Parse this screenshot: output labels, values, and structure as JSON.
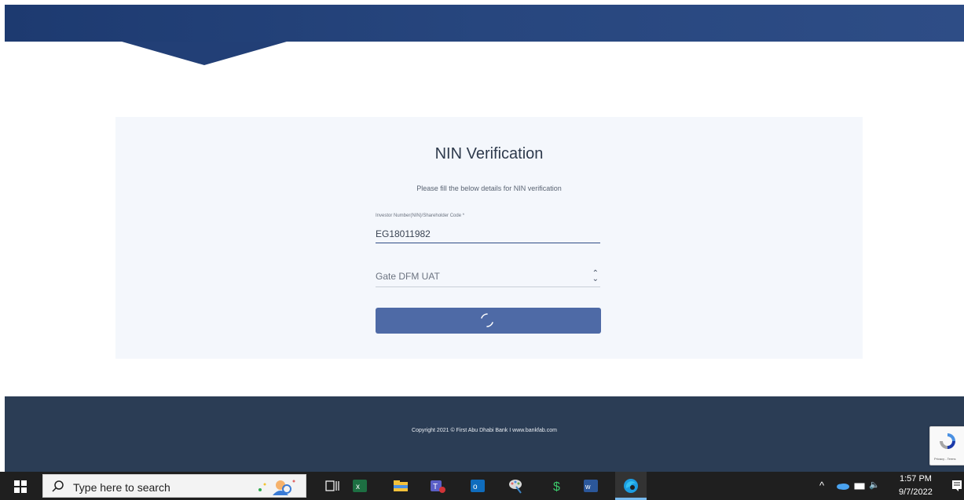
{
  "form": {
    "title": "NIN Verification",
    "subtitle": "Please fill the below details for NIN verification",
    "field_label": "Investor Number(NIN)/Shareholder Code *",
    "field_value": "EG18011982",
    "select_value": "Gate DFM UAT"
  },
  "footer": {
    "copyright": "Copyright 2021 © First Abu Dhabi Bank I www.bankfab.com"
  },
  "recaptcha": {
    "text": "Privacy - Terms"
  },
  "taskbar": {
    "search_placeholder": "Type here to search",
    "time": "1:57 PM",
    "date": "9/7/2022"
  },
  "colors": {
    "header": "#27467e",
    "footer": "#2b3d55",
    "button": "#4e6aa6",
    "card": "#f4f7fc"
  }
}
